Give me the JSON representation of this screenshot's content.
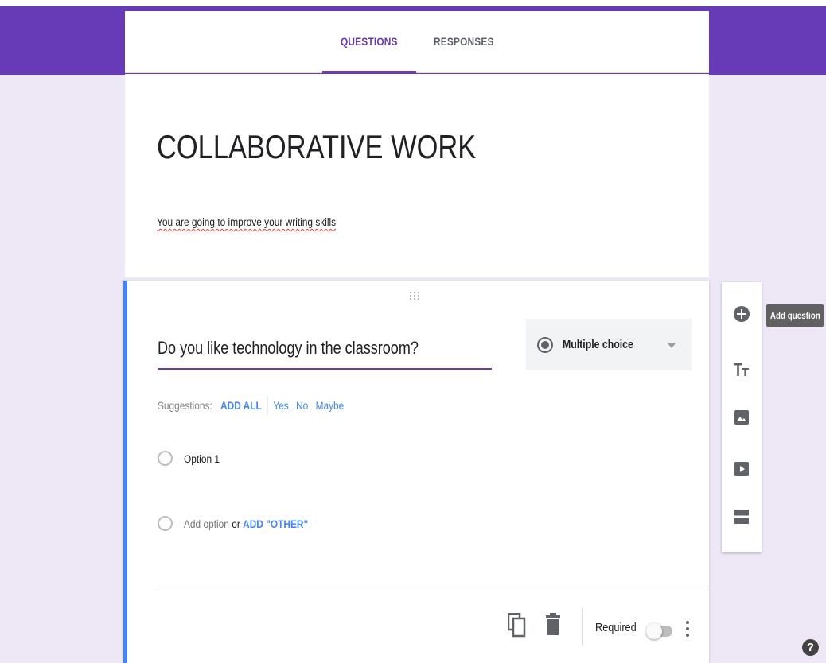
{
  "tabs": [
    {
      "label": "QUESTIONS",
      "active": true
    },
    {
      "label": "RESPONSES",
      "active": false
    }
  ],
  "form": {
    "title": "COLLABORATIVE WORK",
    "description": "You are going to improve  your writing skills"
  },
  "question": {
    "title": "Do you like technology in the classroom?",
    "type_label": "Multiple choice",
    "suggestions_label": "Suggestions:",
    "add_all_label": "ADD ALL",
    "suggestions": [
      "Yes",
      "No",
      "Maybe"
    ],
    "options": [
      "Option 1"
    ],
    "add_option_label": "Add option",
    "or_label": "or",
    "add_other_label": "ADD \"OTHER\"",
    "required_label": "Required",
    "required_on": false
  },
  "toolbar": {
    "tooltip": "Add question",
    "icons": [
      "add-circle-icon",
      "title-text-icon",
      "image-icon",
      "video-icon",
      "section-icon"
    ]
  },
  "help_label": "?",
  "colors": {
    "accent": "#673ab7",
    "background": "#ede7f6",
    "link": "#4285f4",
    "focus_bar": "#4285f4"
  }
}
